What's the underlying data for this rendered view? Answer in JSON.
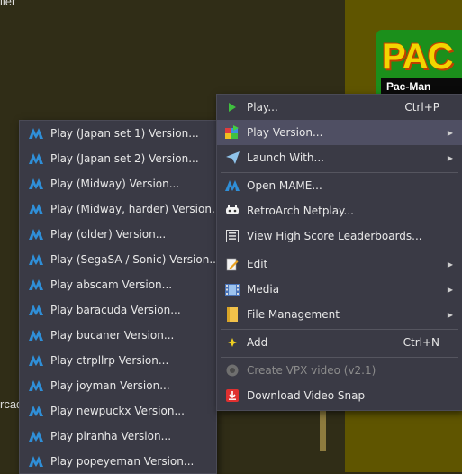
{
  "background": {
    "top_text": "ller",
    "mid_text": "l",
    "arcade_text": "rcad",
    "game_tile": {
      "logo_word": "PAC",
      "caption": "Pac-Man"
    }
  },
  "main_menu": {
    "items": [
      {
        "label": "Play...",
        "shortcut": "Ctrl+P",
        "icon": "play-arrow-icon"
      },
      {
        "label": "Play Version...",
        "icon": "play-version-icon",
        "submenu": true
      },
      {
        "label": "Launch With...",
        "icon": "paper-plane-icon",
        "submenu": true
      },
      {
        "label": "Open MAME...",
        "icon": "mame-icon"
      },
      {
        "label": "RetroArch Netplay...",
        "icon": "retroarch-icon"
      },
      {
        "label": "View High Score Leaderboards...",
        "icon": "leaderboard-icon"
      },
      {
        "label": "Edit",
        "icon": "edit-icon",
        "submenu": true
      },
      {
        "label": "Media",
        "icon": "media-icon",
        "submenu": true
      },
      {
        "label": "File Management",
        "icon": "folder-icon",
        "submenu": true
      },
      {
        "label": "Add",
        "shortcut": "Ctrl+N",
        "icon": "add-icon"
      },
      {
        "label": "Create VPX video (v2.1)",
        "icon": "vpx-icon"
      },
      {
        "label": "Download Video Snap",
        "icon": "download-icon"
      }
    ]
  },
  "sub_menu": {
    "items": [
      "Play (Japan set 1) Version...",
      "Play (Japan set 2) Version...",
      "Play (Midway) Version...",
      "Play (Midway, harder) Version...",
      "Play (older) Version...",
      "Play (SegaSA / Sonic) Version...",
      "Play abscam Version...",
      "Play baracuda Version...",
      "Play bucaner Version...",
      "Play ctrpllrp Version...",
      "Play joyman Version...",
      "Play newpuckx Version...",
      "Play piranha Version...",
      "Play popeyeman Version..."
    ]
  },
  "colors": {
    "menu_bg": "#3a3a45",
    "highlight": "#4f4f63",
    "mame_icon": "#2f8fd8"
  }
}
